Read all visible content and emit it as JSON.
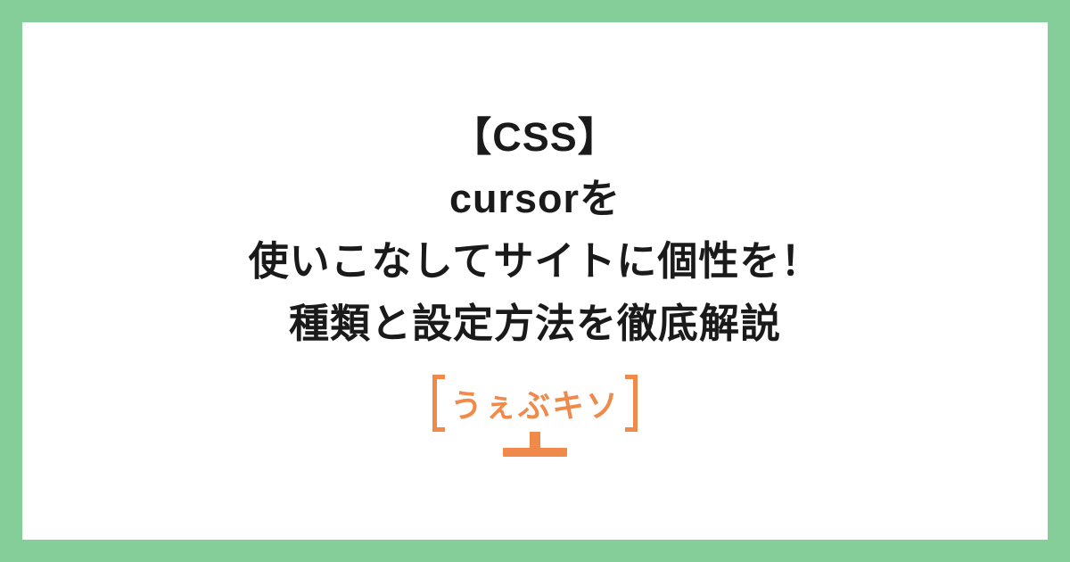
{
  "title": {
    "line1": "【CSS】",
    "line2": "cursorを",
    "line3": "使いこなしてサイトに個性を！",
    "line4": "種類と設定方法を徹底解説"
  },
  "logo": {
    "text": "うぇぶキソ"
  },
  "colors": {
    "border": "#85ce9a",
    "background": "#ffffff",
    "text": "#1a1a1a",
    "accent": "#f08a4b"
  }
}
